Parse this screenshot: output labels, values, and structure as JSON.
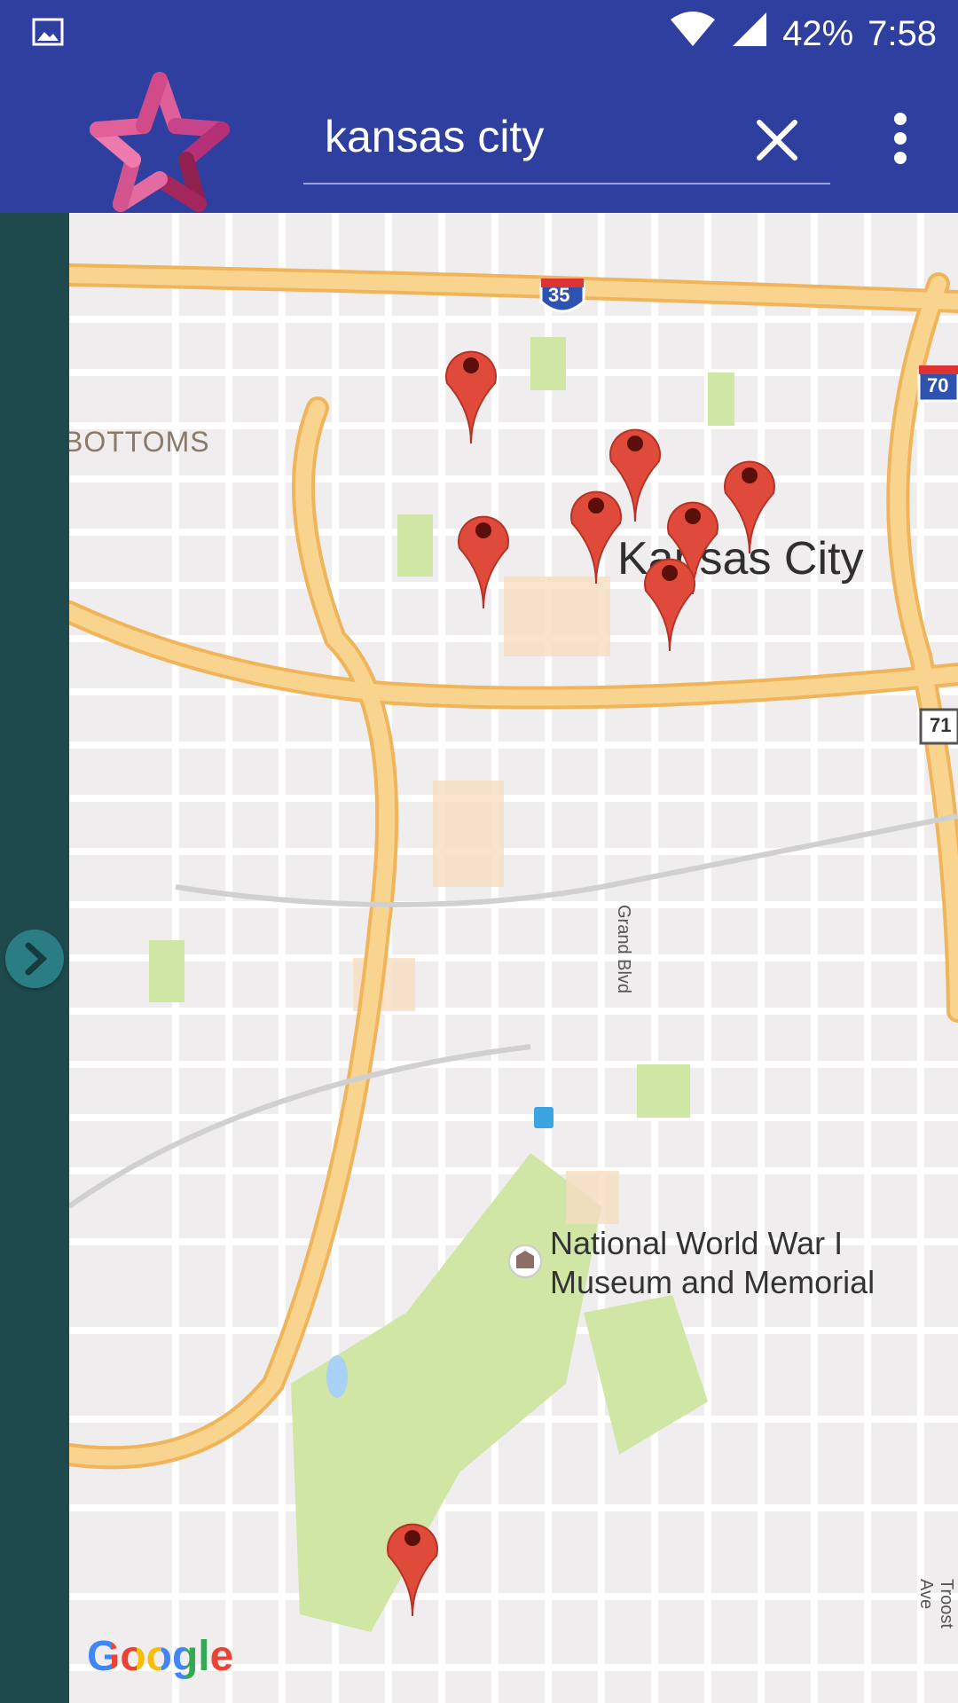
{
  "status_bar": {
    "battery": "42%",
    "time": "7:58",
    "icons": [
      "image-icon",
      "wifi-icon",
      "signal-icon"
    ]
  },
  "toolbar": {
    "search_value": "kansas city",
    "clear_icon": "close-icon",
    "overflow_icon": "more-vert-icon",
    "logo": "star-hands-logo"
  },
  "map": {
    "labels": {
      "city": "Kansas City",
      "district": "BOTTOMS",
      "street1": "Grand Blvd",
      "street2": "Troost Ave",
      "poi_line1": "National World War I",
      "poi_line2": "Museum and Memorial"
    },
    "route_shields": {
      "interstate_35": "35",
      "interstate_70": "70",
      "us_71": "71"
    },
    "pins_count": 9,
    "attribution": "Google"
  },
  "colors": {
    "primary": "#2f3f9f",
    "sidebar": "#1f4a4d",
    "pin": "#e04a3a",
    "highway": "#f7c978",
    "park": "#cfe6a4"
  }
}
